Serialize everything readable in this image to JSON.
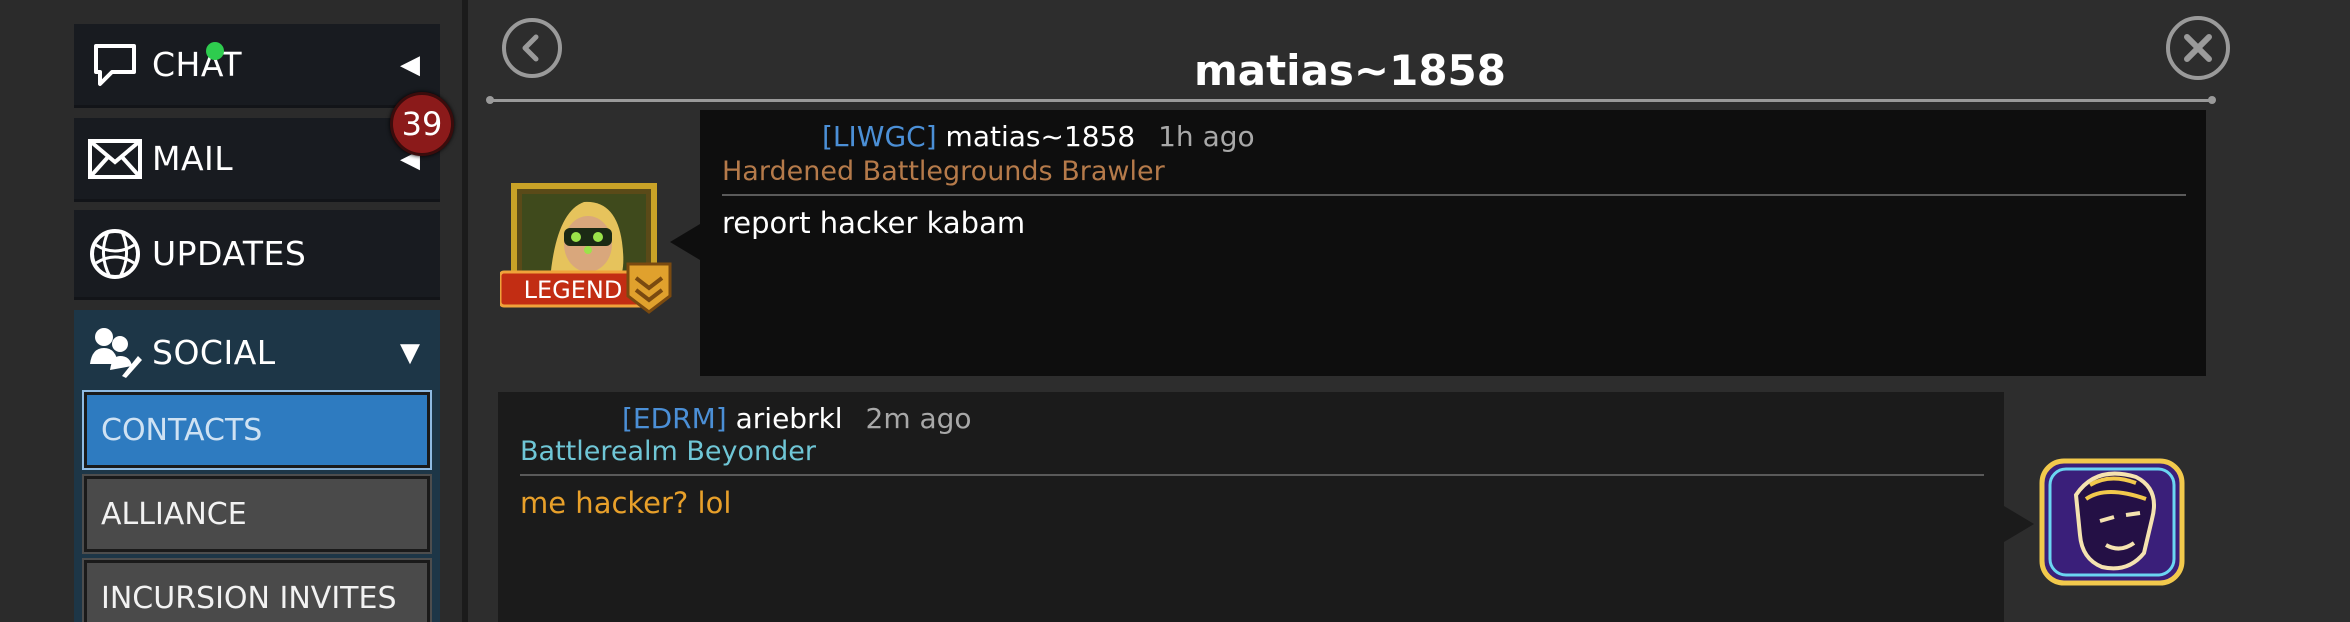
{
  "sidebar": {
    "chat": {
      "label": "CHAT"
    },
    "mail": {
      "label": "MAIL",
      "badge": "39"
    },
    "updates": {
      "label": "UPDATES"
    },
    "social": {
      "label": "SOCIAL",
      "items": [
        {
          "label": "CONTACTS",
          "active": true
        },
        {
          "label": "ALLIANCE",
          "active": false
        },
        {
          "label": "INCURSION INVITES",
          "active": false
        }
      ]
    }
  },
  "conversation": {
    "title": "matias~1858",
    "messages": [
      {
        "alliance": "[LIWGC]",
        "user": "matias~1858",
        "time": "1h ago",
        "subtitle": "Hardened Battlegrounds Brawler",
        "subtitle_color": "#b57a4a",
        "text": "report hacker kabam",
        "text_color": "#ffffff",
        "avatar_badge": "LEGEND"
      },
      {
        "alliance": "[EDRM]",
        "user": "ariebrkl",
        "time": "2m ago",
        "subtitle": "Battlerealm Beyonder",
        "subtitle_color": "#6fc6d6",
        "text": "me hacker? lol",
        "text_color": "#e8a02a"
      }
    ]
  },
  "colors": {
    "active_tab": "#2e7bc0",
    "social_bg": "#1d3647",
    "alliance_tag": "#4b8fd6",
    "badge": "#8b1a1a"
  },
  "icons": {
    "chat": "speech-bubble-icon",
    "mail": "envelope-icon",
    "updates": "globe-icon",
    "social": "people-icon",
    "back": "back-arrow-icon",
    "close": "close-icon"
  }
}
